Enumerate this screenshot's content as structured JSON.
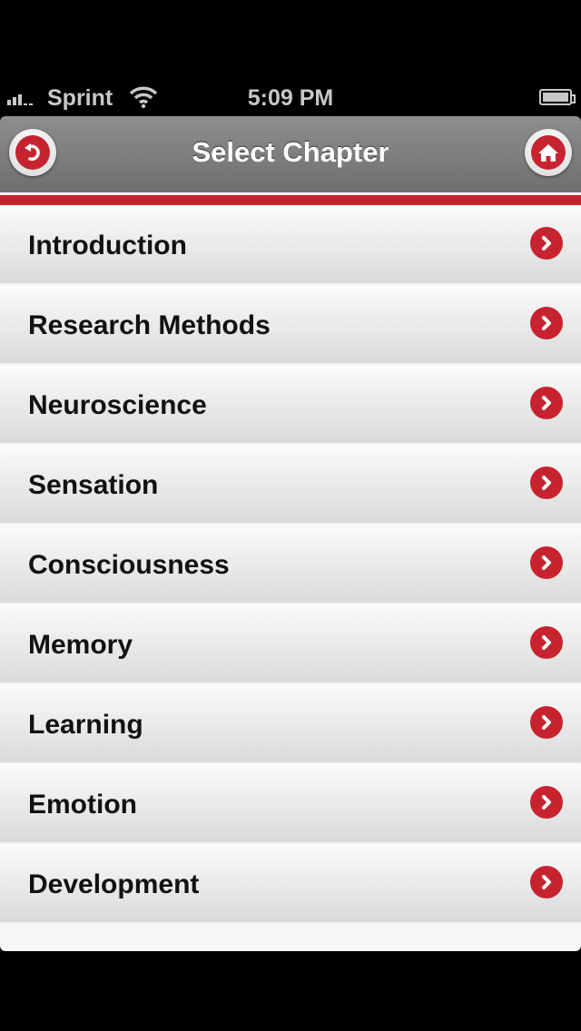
{
  "status_bar": {
    "carrier": "Sprint",
    "time": "5:09 PM",
    "signal_icon": "signal-bars-icon",
    "wifi_icon": "wifi-icon",
    "battery_icon": "battery-icon"
  },
  "nav": {
    "title": "Select Chapter",
    "back_icon": "back-arrow-icon",
    "home_icon": "home-icon"
  },
  "colors": {
    "accent": "#c4262f",
    "navbar": "#7e7e7e"
  },
  "chapters": [
    {
      "label": "Introduction"
    },
    {
      "label": "Research Methods"
    },
    {
      "label": "Neuroscience"
    },
    {
      "label": "Sensation"
    },
    {
      "label": "Consciousness"
    },
    {
      "label": "Memory"
    },
    {
      "label": "Learning"
    },
    {
      "label": "Emotion"
    },
    {
      "label": "Development"
    }
  ]
}
